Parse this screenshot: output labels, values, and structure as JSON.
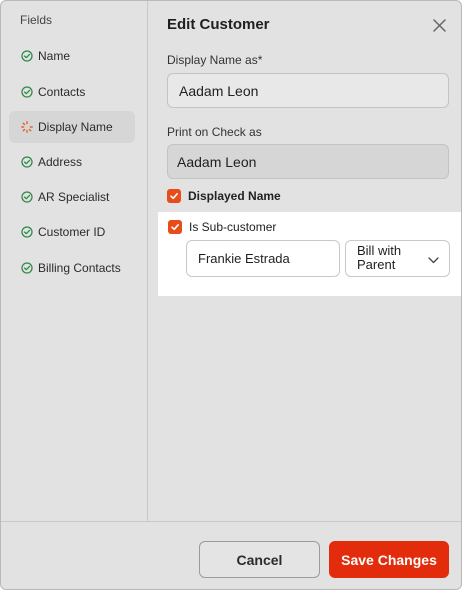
{
  "sidebar": {
    "title": "Fields",
    "items": [
      {
        "label": "Name",
        "icon": "check-circle-icon",
        "status": "done"
      },
      {
        "label": "Contacts",
        "icon": "check-circle-icon",
        "status": "done"
      },
      {
        "label": "Display Name",
        "icon": "loading-spinner-icon",
        "status": "in-progress"
      },
      {
        "label": "Address",
        "icon": "check-circle-icon",
        "status": "done"
      },
      {
        "label": "AR Specialist",
        "icon": "check-circle-icon",
        "status": "done"
      },
      {
        "label": "Customer ID",
        "icon": "check-circle-icon",
        "status": "done"
      },
      {
        "label": "Billing Contacts",
        "icon": "check-circle-icon",
        "status": "done"
      }
    ]
  },
  "dialog": {
    "title": "Edit Customer",
    "close_icon": "close-icon"
  },
  "form": {
    "display_name_label": "Display Name as*",
    "display_name_value": "Aadam Leon",
    "print_on_check_label": "Print on Check as",
    "print_on_check_value": "Aadam Leon",
    "displayed_name_label": "Displayed Name",
    "displayed_name_checked": true,
    "sub_customer_label": "Is Sub-customer",
    "sub_customer_checked": true,
    "parent_customer_value": "Frankie Estrada",
    "billing_select_value": "Bill with Parent"
  },
  "footer": {
    "cancel_label": "Cancel",
    "save_label": "Save Changes"
  },
  "colors": {
    "accent": "#e32c0c",
    "check_green": "#2f8a4a",
    "spinner_orange": "#e8602c",
    "background": "#e2e2e2"
  }
}
